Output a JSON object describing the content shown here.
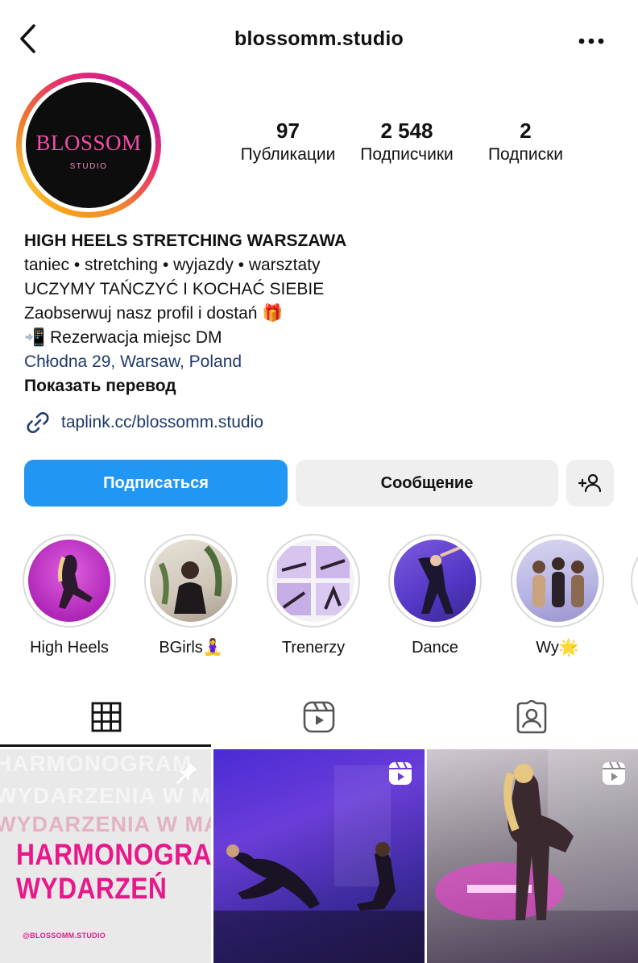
{
  "header": {
    "title": "blossomm.studio"
  },
  "avatar": {
    "brand": "BLOSSOM",
    "brand_sub": "STUDIO"
  },
  "stats": {
    "posts": {
      "value": "97",
      "label": "Публикации"
    },
    "followers": {
      "value": "2 548",
      "label": "Подписчики"
    },
    "following": {
      "value": "2",
      "label": "Подписки"
    }
  },
  "bio": {
    "name": "HIGH HEELS STRETCHING WARSZAWA",
    "lines": [
      "taniec • stretching • wyjazdy • warsztaty",
      "UCZYMY TAŃCZYĆ I KOCHAĆ SIEBIE",
      "Zaobserwuj nasz profil i dostań 🎁",
      "📲 Rezerwacja miejsc DM"
    ],
    "location": "Chłodna 29, Warsaw, Poland",
    "translate": "Показать перевод"
  },
  "link": {
    "text": "taplink.cc/blossomm.studio"
  },
  "buttons": {
    "follow": "Подписаться",
    "message": "Сообщение"
  },
  "highlights": [
    {
      "label": "High Heels"
    },
    {
      "label": "BGirls🧘‍♀️"
    },
    {
      "label": "Trenerzy"
    },
    {
      "label": "Dance"
    },
    {
      "label": "Wy🌟"
    }
  ],
  "tabs": [
    "grid-icon",
    "reels-icon",
    "tagged-icon"
  ],
  "posts": {
    "first": {
      "ghost_1": "HARMONOGRAM",
      "ghost_2": "WYDARZENIA W MAJU",
      "ghost_3": "WYDARZENIA W MAJU",
      "title_1": "HARMONOGRAM",
      "title_2": "WYDARZEŃ",
      "handle": "@BLOSSOMM.STUDIO"
    }
  },
  "colors": {
    "primary_button": "#2196f3",
    "link": "#1e3a6e",
    "accent_pink": "#e8178a"
  }
}
